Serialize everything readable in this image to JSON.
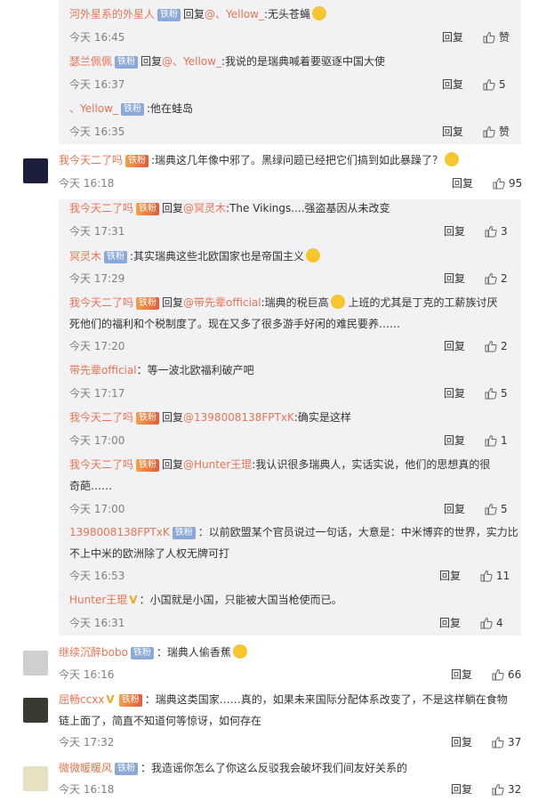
{
  "reply_label": "回复",
  "like_label": "赞",
  "badges": {
    "tie": "铁粉"
  },
  "comments": [
    {
      "user": "河外星系的外星人",
      "badge": "铁粉",
      "text1": "回复",
      "at": "@、Yellow_",
      "text2": ":无头苍蝇",
      "time": "今天 16:45",
      "likes": "赞"
    },
    {
      "user": "瑟兰佩佩",
      "badge": "铁粉",
      "text1": "回复",
      "at": "@、Yellow_",
      "text2": ":我说的是瑞典喊着要驱逐中国大使",
      "time": "今天 16:37",
      "likes": "5"
    },
    {
      "user": "、Yellow_",
      "badge": "铁粉",
      "text2": ":他在蛙岛",
      "time": "今天 16:35",
      "likes": "赞"
    },
    {
      "user": "我今天二了吗",
      "badge": "铁粉",
      "text2": ":瑞典这几年像中邪了。黑绿问题已经把它们搞到如此暴躁了？",
      "time": "今天 16:18",
      "likes": "95"
    },
    {
      "user": "我今天二了吗",
      "badge": "铁粉",
      "text1": "回复",
      "at": "@冥灵木",
      "text2": ":The Vikings....强盗基因从未改变",
      "time": "今天 17:31",
      "likes": "3"
    },
    {
      "user": "冥灵木",
      "badge": "铁粉",
      "text2": ":其实瑞典这些北欧国家也是帝国主义",
      "time": "今天 17:29",
      "likes": "2"
    },
    {
      "user": "我今天二了吗",
      "badge": "铁粉",
      "text1": "回复",
      "at": "@带先辈official",
      "text2": ":瑞典的税巨高",
      "text3": "上班的尤其是丁克的工薪族讨厌",
      "text4": "死他们的福利和个税制度了。现在又多了很多游手好闲的难民要养……",
      "time": "今天 17:20",
      "likes": "2"
    },
    {
      "user": "带先辈official",
      "text2": "：等一波北欧福利破产吧",
      "time": "今天 17:17",
      "likes": "5"
    },
    {
      "user": "我今天二了吗",
      "badge": "铁粉",
      "text1": "回复",
      "at": "@1398008138FPTxK",
      "text2": ":确实是这样",
      "time": "今天 17:00",
      "likes": "1"
    },
    {
      "user": "我今天二了吗",
      "badge": "铁粉",
      "text1": "回复",
      "at": "@Hunter王琨",
      "text2": ":我认识很多瑞典人，实话实说，他们的思想真的很",
      "text4": "奇葩……",
      "time": "今天 17:00",
      "likes": "5"
    },
    {
      "user": "1398008138FPTxK",
      "badge": "铁粉",
      "text2": "：以前欧盟某个官员说过一句话，大意是：中米博弈的世界，实力比",
      "text4": "不上中米的欧洲除了人权无牌可打",
      "time": "今天 16:53",
      "likes": "11"
    },
    {
      "user": "Hunter王琨",
      "text2": "：小国就是小国，只能被大国当枪使而已。",
      "time": "今天 16:31",
      "likes": "4"
    },
    {
      "user": "继续沉醉bobo",
      "badge": "铁粉",
      "text2": "：瑞典人偷香蕉",
      "time": "今天 16:16",
      "likes": "66"
    },
    {
      "user": "屈畅ccxx",
      "badge": "铁粉",
      "text2": "：瑞典这类国家……真的，如果未来国际分配体系改变了，不是这样躺在食物",
      "text4": "链上面了，简直不知道何等惊讶，如何存在",
      "time": "今天 17:32",
      "likes": "37"
    },
    {
      "user": "微微暖暖风",
      "badge": "铁粉",
      "text2": "：我造谣你怎么了你这么反驳我会破坏我们间友好关系的",
      "time": "今天 16:18",
      "likes": "32"
    }
  ]
}
